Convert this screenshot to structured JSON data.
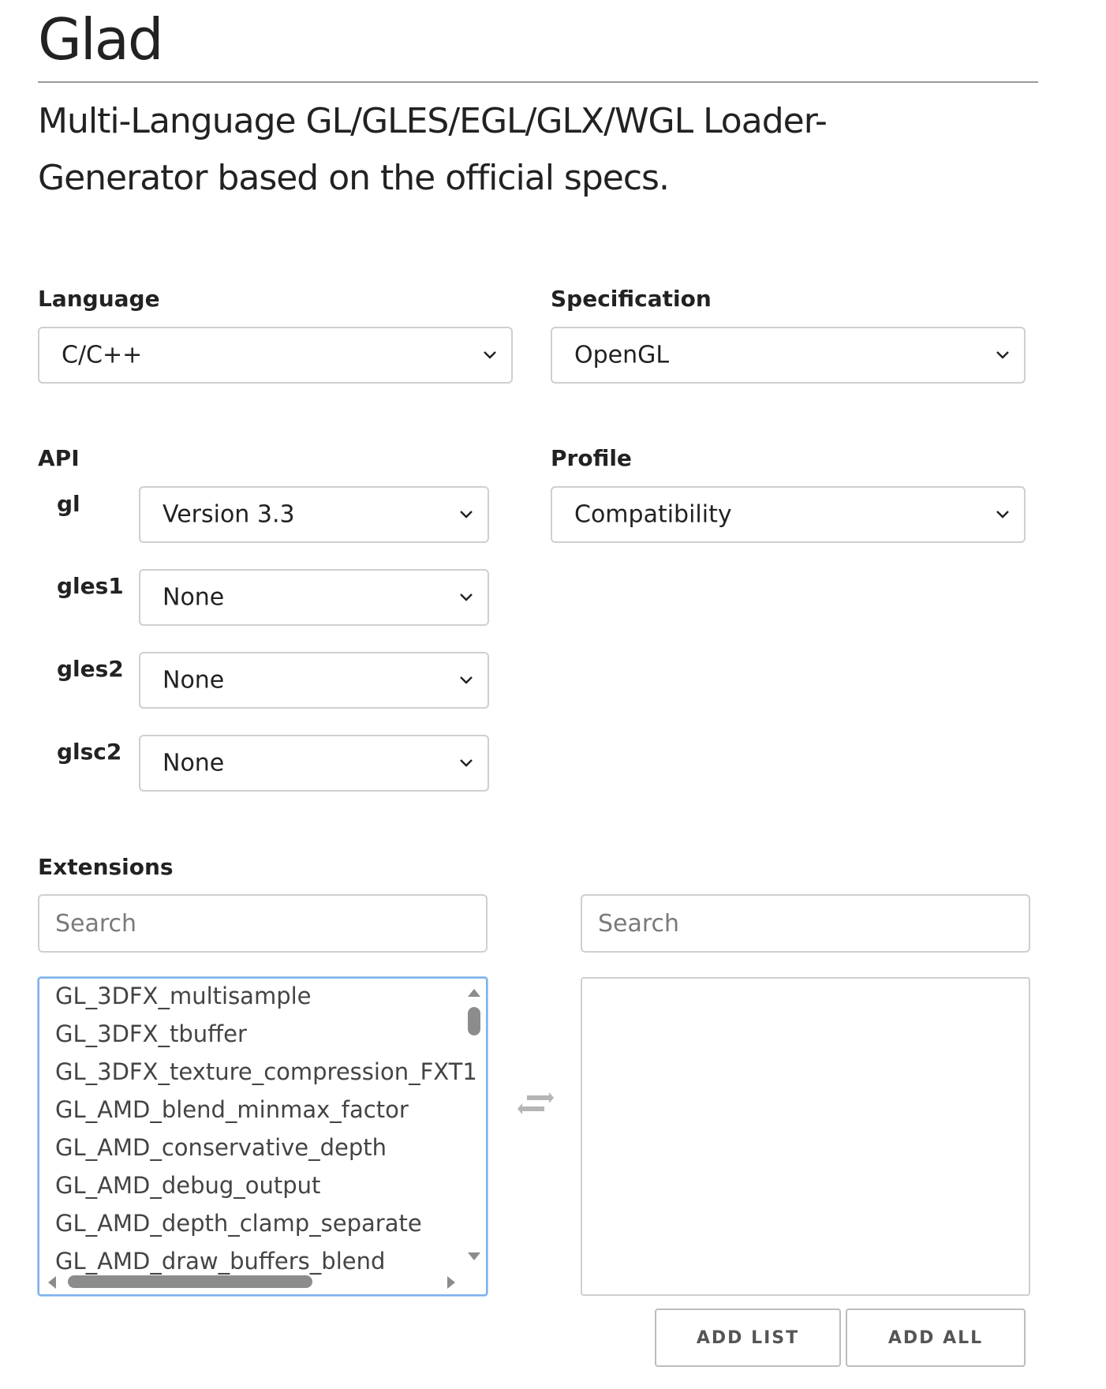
{
  "header": {
    "title": "Glad",
    "subtitle": "Multi-Language GL/GLES/EGL/GLX/WGL Loader-Generator based on the official specs."
  },
  "language": {
    "label": "Language",
    "value": "C/C++"
  },
  "specification": {
    "label": "Specification",
    "value": "OpenGL"
  },
  "api": {
    "label": "API",
    "items": [
      {
        "name": "gl",
        "value": "Version 3.3"
      },
      {
        "name": "gles1",
        "value": "None"
      },
      {
        "name": "gles2",
        "value": "None"
      },
      {
        "name": "glsc2",
        "value": "None"
      }
    ]
  },
  "profile": {
    "label": "Profile",
    "value": "Compatibility"
  },
  "extensions": {
    "label": "Extensions",
    "search_left_placeholder": "Search",
    "search_right_placeholder": "Search",
    "available": [
      "GL_3DFX_multisample",
      "GL_3DFX_tbuffer",
      "GL_3DFX_texture_compression_FXT1",
      "GL_AMD_blend_minmax_factor",
      "GL_AMD_conservative_depth",
      "GL_AMD_debug_output",
      "GL_AMD_depth_clamp_separate",
      "GL_AMD_draw_buffers_blend"
    ],
    "selected": [],
    "add_list_label": "ADD LIST",
    "add_all_label": "ADD ALL"
  },
  "icons": {
    "dropdown": "chevron-down-icon",
    "swap": "swap-arrows-icon"
  },
  "colors": {
    "border": "#cfcfcf",
    "focus_border": "#7fb2ea",
    "text": "#222222"
  }
}
